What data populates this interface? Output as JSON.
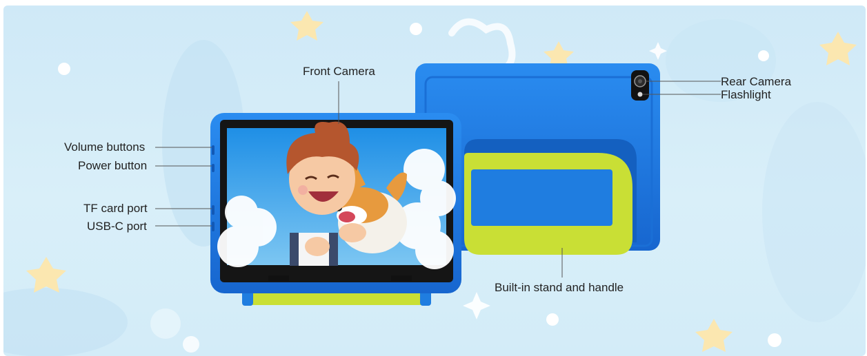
{
  "callouts": {
    "front_camera": "Front Camera",
    "volume_buttons": "Volume buttons",
    "power_button": "Power button",
    "tf_card_port": "TF card port",
    "usb_c_port": "USB-C port",
    "rear_camera": "Rear Camera",
    "flashlight": "Flashlight",
    "stand_handle": "Built-in stand and handle"
  },
  "colors": {
    "background": "#d4ecf8",
    "case_blue": "#1f7de0",
    "case_blue_dark": "#1563c4",
    "handle_lime": "#c9df35",
    "screen_bezel": "#151515"
  }
}
